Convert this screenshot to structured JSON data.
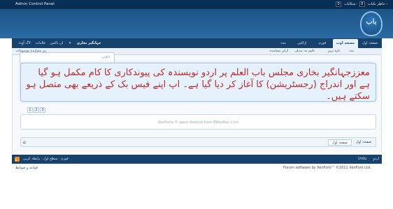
{
  "adminbar": {
    "title": "Admin Control Panel",
    "alerts": [
      {
        "label": "شکایات:",
        "count": "0"
      },
      {
        "label": "حاظر نکتات :",
        "count": "0"
      }
    ]
  },
  "logo": {
    "text": "باب"
  },
  "nav": {
    "tabs": [
      {
        "label": "صفحہ اول",
        "active": false
      },
      {
        "label": "مسجد اوپ",
        "active": true
      },
      {
        "label": "فورم",
        "active": false
      },
      {
        "label": "اراکین",
        "active": false
      },
      {
        "label": "مدد",
        "active": false
      }
    ],
    "user_tabs": [
      {
        "label": "جہانگیر بخاری"
      },
      {
        "label": "ان باکس"
      },
      {
        "label": "علامات"
      },
      {
        "label": "لاگ آؤٹ"
      }
    ],
    "sub_items": [
      {
        "label": "ارکی مشاہدہ"
      },
      {
        "label": "تلاش مہ تبدیلی"
      },
      {
        "label": "تازہ ترین"
      },
      {
        "label": "مدد"
      },
      {
        "label": "زیر مشاہدہ موضوعات"
      }
    ]
  },
  "smallbox": {
    "label": "اعلانی"
  },
  "notice": {
    "text": "معززجہانگیر بخاری مجلس باب العلم پر اردو نویسندہ کی پیوندکاری کا کام مکمل ہو گیا ہے اور اندراج (رجسٹریشن) کا آغاز کر دیا گیا ہے۔ اپ اپنے فیس بک کے ذریعے بھی متصل ہو سکتے ہیں۔"
  },
  "pager": [
    "1",
    "2",
    "3"
  ],
  "footerbox": {
    "credit": "XenPorta © Jason Axelrod from 8WayRun.Com"
  },
  "breadcrumb": {
    "home_icon": "home-icon",
    "items": [
      "صفحہ اول",
      "صفحہ اول"
    ],
    "right": "صفحہ اول"
  },
  "bottombar": {
    "left_links": "فورم  ·  سطح اول  ·  رابطہ کریں",
    "lang": "Urdu",
    "style": "اردو"
  },
  "footer": {
    "legal": "قواعد و ضوابط",
    "copyright": "Forum software by XenForo™ ©2011 XenForo Ltd."
  }
}
